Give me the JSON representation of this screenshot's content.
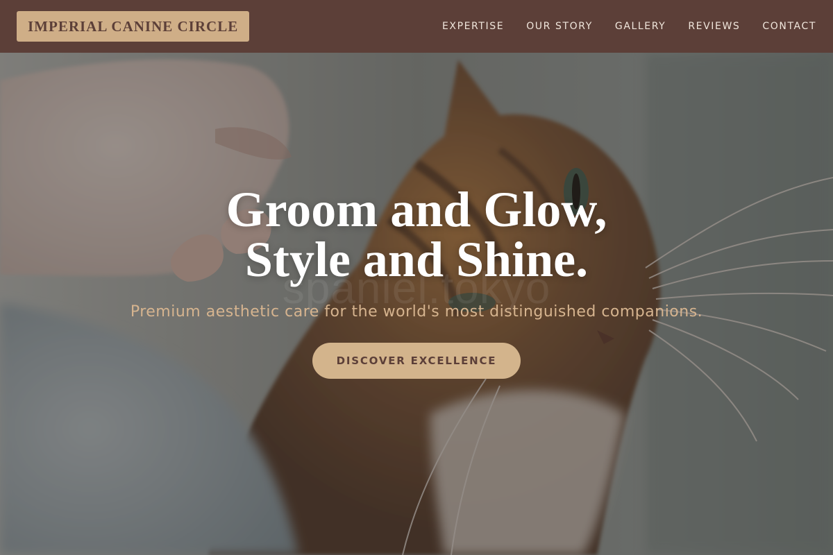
{
  "brand": {
    "name": "IMPERIAL CANINE CIRCLE"
  },
  "nav": {
    "items": [
      {
        "label": "EXPERTISE"
      },
      {
        "label": "OUR STORY"
      },
      {
        "label": "GALLERY"
      },
      {
        "label": "REVIEWS"
      },
      {
        "label": "CONTACT"
      }
    ]
  },
  "hero": {
    "title_line1": "Groom and Glow,",
    "title_line2": "Style and Shine.",
    "watermark": "spaniel.tokyo",
    "subtitle": "Premium aesthetic care for the world's most distinguished companions.",
    "cta_label": "DISCOVER EXCELLENCE",
    "image_subject": "cat-being-petted-photo"
  },
  "colors": {
    "header_bg": "#5c3f38",
    "logo_bg": "#cfae87",
    "accent": "#d3b48c",
    "subtitle": "#d6b48f",
    "nav_text": "#f0e6dc"
  }
}
